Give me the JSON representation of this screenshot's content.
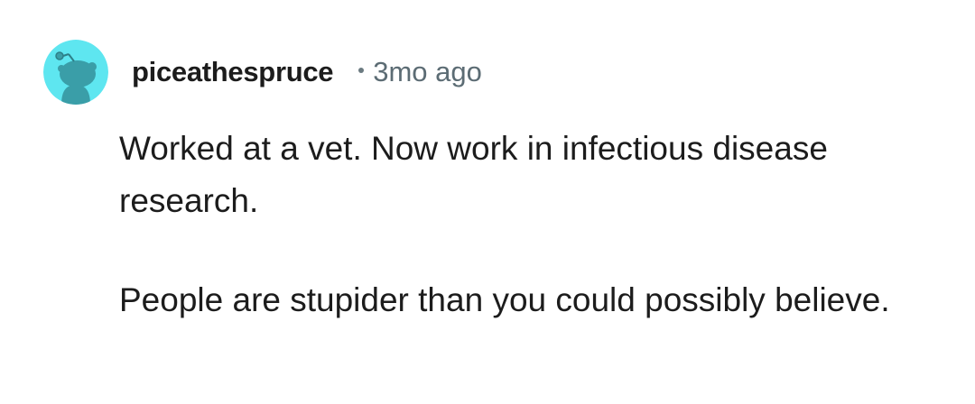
{
  "comment": {
    "author": "piceathespruce",
    "separator_icon": "bullet-dot-icon",
    "timestamp": "3mo ago",
    "avatar_icon": "reddit-snoo-avatar-icon",
    "avatar_color": "#5ee6f0",
    "paragraphs": [
      "Worked at a vet. Now work in infectious disease research.",
      "People are stupider than you could possibly believe."
    ]
  },
  "colors": {
    "text": "#1c1c1c",
    "meta": "#5c6c74",
    "background": "#ffffff"
  }
}
